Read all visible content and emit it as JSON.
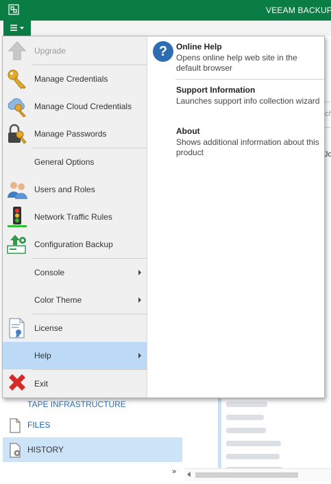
{
  "app": {
    "title": "VEEAM BACKUP A"
  },
  "menu": {
    "items": [
      {
        "label": "Upgrade",
        "icon": "upgrade-arrow-icon",
        "disabled": true
      },
      {
        "label": "Manage Credentials",
        "icon": "key-icon"
      },
      {
        "label": "Manage Cloud Credentials",
        "icon": "cloud-key-icon"
      },
      {
        "label": "Manage Passwords",
        "icon": "lock-key-icon"
      },
      {
        "label": "General Options",
        "icon": ""
      },
      {
        "label": "Users and Roles",
        "icon": "users-icon"
      },
      {
        "label": "Network Traffic Rules",
        "icon": "traffic-light-icon"
      },
      {
        "label": "Configuration Backup",
        "icon": "config-backup-icon"
      },
      {
        "label": "Console",
        "icon": "",
        "submenu": true
      },
      {
        "label": "Color Theme",
        "icon": "",
        "submenu": true
      },
      {
        "label": "License",
        "icon": "license-document-icon"
      },
      {
        "label": "Help",
        "icon": "",
        "submenu": true,
        "active": true
      },
      {
        "label": "Exit",
        "icon": "exit-x-icon"
      }
    ]
  },
  "help_submenu": [
    {
      "title": "Online Help",
      "description": "Opens online help web site in the default browser"
    },
    {
      "title": "Support Information",
      "description": "Launches support info collection wizard"
    },
    {
      "title": "About",
      "description": "Shows additional information about this product"
    }
  ],
  "background": {
    "nav": {
      "partial_label": "TAPE INFRASTRUCTURE",
      "files_label": "FILES",
      "history_label": "HISTORY"
    },
    "search_placeholder": "ch",
    "partial_column_text": "Jo"
  },
  "colors": {
    "brand_green": "#0a7d45",
    "menu_active": "#bcd9f5",
    "nav_selected": "#cde3f7",
    "help_blue": "#2d6eb3",
    "exit_red": "#d42a2a"
  }
}
